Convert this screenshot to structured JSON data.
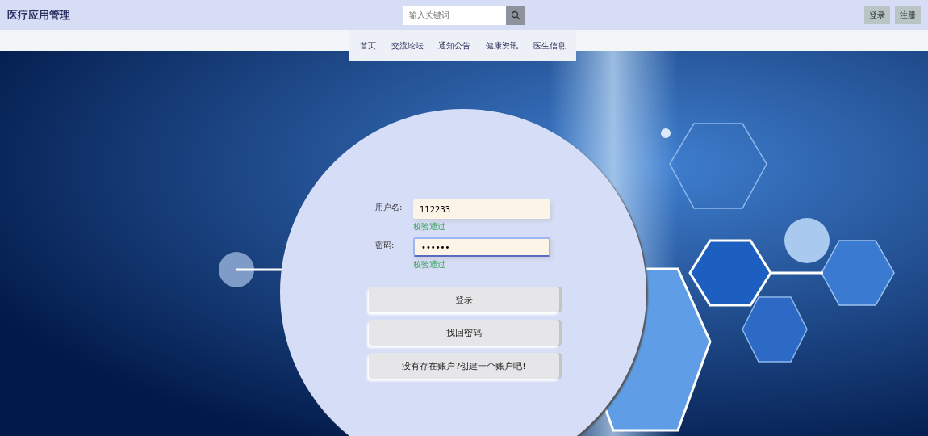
{
  "header": {
    "title": "医疗应用管理",
    "search": {
      "placeholder": "输入关键词"
    },
    "buttons": [
      "登录",
      "注册"
    ]
  },
  "nav": {
    "items": [
      {
        "label": "首页"
      },
      {
        "label": "交流论坛"
      },
      {
        "label": "通知公告"
      },
      {
        "label": "健康资讯"
      },
      {
        "label": "医生信息"
      }
    ]
  },
  "login_form": {
    "fields": [
      {
        "label": "用户名:",
        "value": "112233",
        "hint": "校验通过",
        "focused": false
      },
      {
        "label": "密码:",
        "value": "••••••",
        "hint": "校验通过",
        "focused": true
      }
    ],
    "buttons": [
      "登录",
      "找回密码",
      "没有存在账户?创建一个账户吧!"
    ]
  }
}
